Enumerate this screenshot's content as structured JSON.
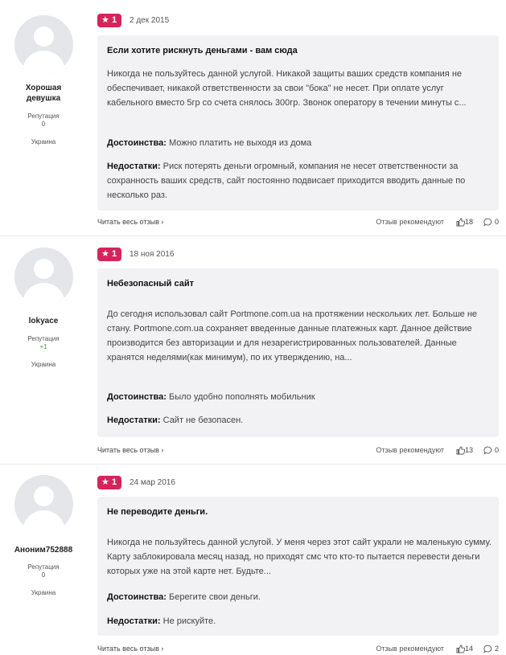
{
  "reviews": [
    {
      "author": "Хорошая девушка",
      "reputation_label": "Репутация",
      "reputation": "0",
      "country": "Украина",
      "rating": "1",
      "date": "2 дек 2015",
      "title": "Если хотите рискнуть деньгами - вам сюда",
      "text": "Никогда не пользуйтесь данной услугой. Никакой защиты ваших средств компания не обеспечивает, никакой ответственности за свои \"бока\" не несет. При оплате услуг кабельного вместо 5гр со счета снялось 300гр. Звонок оператору в течении минуты с...",
      "pros_label": "Достоинства:",
      "pros": "Можно платить не выходя из дома",
      "cons_label": "Недостатки:",
      "cons": "Риск потерять деньги огромный, компания не несет ответственности за сохранность ваших средств, сайт постоянно подвисает приходится вводить данные по несколько раз.",
      "read_more": "Читать весь отзыв",
      "recommend": "Отзыв рекомендуют",
      "likes": "18",
      "comments": "0"
    },
    {
      "author": "lokyace",
      "reputation_label": "Репутация",
      "reputation": "+1",
      "country": "Украина",
      "rating": "1",
      "date": "18 ноя 2016",
      "title": "Небезопасный сайт",
      "text": "До сегодня использовал сайт Portmone.com.ua на протяжении нескольких лет. Больше не стану. Portmone.com.ua сохраняет введенные данные платежных карт. Данное действие производится без авторизации и для незарегистрированных пользователей. Данные хранятся неделями(как минимум), по их утверждению, на...",
      "pros_label": "Достоинства:",
      "pros": "Было удобно пополнять мобильник",
      "cons_label": "Недостатки:",
      "cons": "Сайт не безопасен.",
      "read_more": "Читать весь отзыв",
      "recommend": "Отзыв рекомендуют",
      "likes": "13",
      "comments": "0"
    },
    {
      "author": "Аноним752888",
      "reputation_label": "Репутация",
      "reputation": "0",
      "country": "Украина",
      "rating": "1",
      "date": "24 мар 2016",
      "title": "Не переводите деньги.",
      "text": "Никогда не пользуйтесь данной услугой. У меня через этот сайт украли не маленькую сумму. Карту заблокировала месяц назад, но приходят смс что кто-то пытается перевести деньги которых уже на этой карте нет. Будьте...",
      "pros_label": "Достоинства:",
      "pros": "Берегите свои деньги.",
      "cons_label": "Недостатки:",
      "cons": "Не рискуйте.",
      "read_more": "Читать весь отзыв",
      "recommend": "Отзыв рекомендуют",
      "likes": "14",
      "comments": "2"
    }
  ],
  "colors": {
    "badge": "#d6245b",
    "card_bg": "#f2f2f4",
    "positive_rep": "#3c9a3c"
  }
}
